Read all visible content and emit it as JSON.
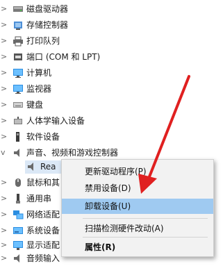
{
  "tree": {
    "items": [
      {
        "label": "磁盘驱动器",
        "icon": "disk-drive-icon",
        "expanded": false
      },
      {
        "label": "存储控制器",
        "icon": "storage-controller-icon",
        "expanded": false
      },
      {
        "label": "打印队列",
        "icon": "printer-icon",
        "expanded": false
      },
      {
        "label": "端口 (COM 和 LPT)",
        "icon": "port-icon",
        "expanded": false
      },
      {
        "label": "计算机",
        "icon": "computer-icon",
        "expanded": false
      },
      {
        "label": "监视器",
        "icon": "monitor-icon",
        "expanded": false
      },
      {
        "label": "键盘",
        "icon": "keyboard-icon",
        "expanded": false
      },
      {
        "label": "人体学输入设备",
        "icon": "hid-icon",
        "expanded": false
      },
      {
        "label": "软件设备",
        "icon": "software-device-icon",
        "expanded": false
      },
      {
        "label": "声音、视频和游戏控制器",
        "icon": "speaker-icon",
        "expanded": true
      },
      {
        "label": "Rea",
        "icon": "speaker-icon",
        "child": true,
        "selected": true
      },
      {
        "label": "鼠标和其",
        "icon": "mouse-icon",
        "expanded": false
      },
      {
        "label": "通用串",
        "icon": "usb-icon",
        "expanded": false
      },
      {
        "label": "网络适配",
        "icon": "network-adapter-icon",
        "expanded": false
      },
      {
        "label": "系统设备",
        "icon": "system-device-icon",
        "expanded": false
      },
      {
        "label": "显示适配",
        "icon": "display-adapter-icon",
        "expanded": false
      },
      {
        "label": "音频输入",
        "icon": "audio-input-icon",
        "expanded": false
      }
    ]
  },
  "context_menu": {
    "items": [
      {
        "label": "更新驱动程序(P)"
      },
      {
        "label": "禁用设备(D)"
      },
      {
        "label": "卸载设备(U)",
        "highlighted": true
      },
      {
        "label": "扫描检测硬件改动(A)"
      },
      {
        "label": "属性(R)",
        "bold": true
      }
    ]
  },
  "colors": {
    "menu_highlight": "#9fcaf1",
    "selection": "#dbe8f6",
    "arrow": "#e02020"
  }
}
